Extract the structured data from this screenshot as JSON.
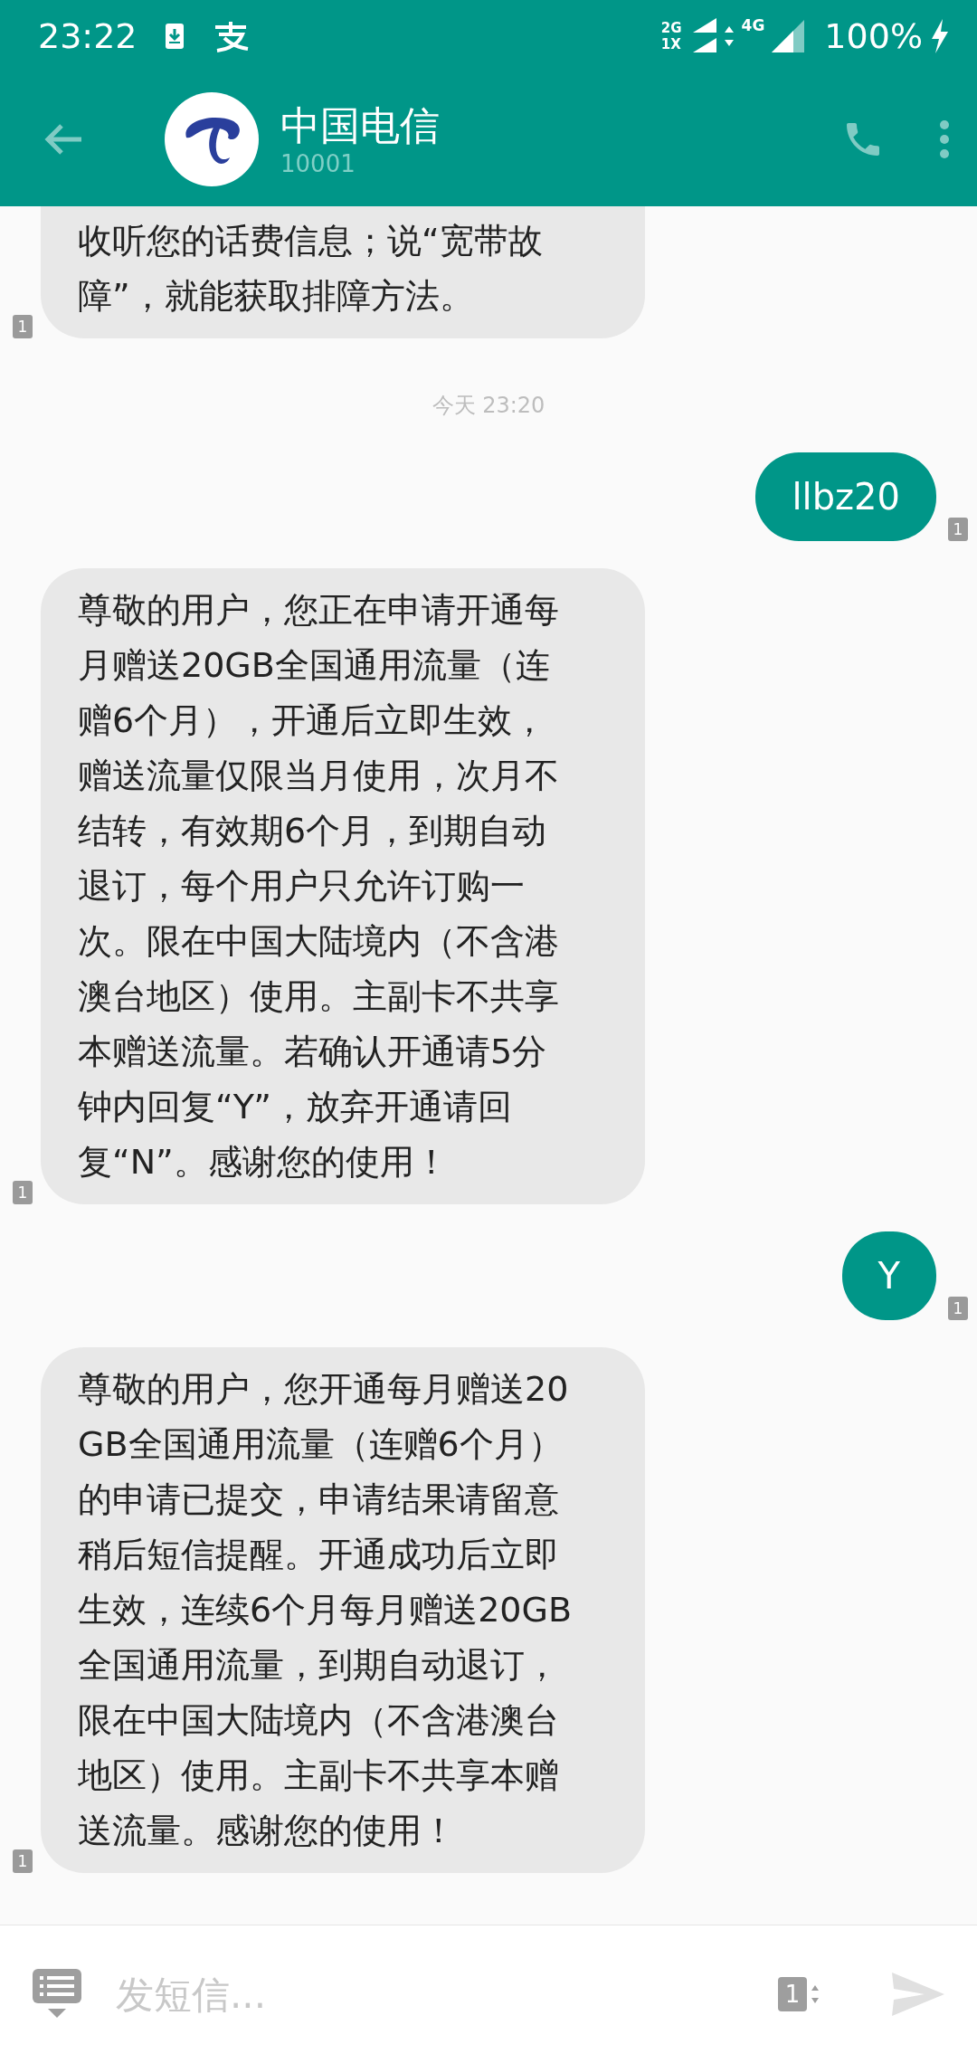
{
  "status_bar": {
    "time": "23:22",
    "network_top": "2G",
    "network_bottom": "1X",
    "network_4g": "4G",
    "battery": "100%"
  },
  "header": {
    "title": "中国电信",
    "subtitle": "10001"
  },
  "messages": [
    {
      "kind": "incoming",
      "text": "收听您的话费信息；说“宽带故障”，就能获取排障方法。",
      "sim": "1",
      "cut_top": true
    },
    {
      "kind": "timestamp",
      "text": "今天 23:20"
    },
    {
      "kind": "outgoing",
      "text": "llbz20",
      "sim": "1"
    },
    {
      "kind": "incoming",
      "text": "尊敬的用户，您正在申请开通每月赠送20GB全国通用流量（连赠6个月），开通后立即生效，赠送流量仅限当月使用，次月不结转，有效期6个月，到期自动退订，每个用户只允许订购一次。限在中国大陆境内（不含港澳台地区）使用。主副卡不共享本赠送流量。若确认开通请5分钟内回复“Y”，放弃开通请回复“N”。感谢您的使用！",
      "sim": "1"
    },
    {
      "kind": "outgoing",
      "text": "Y",
      "sim": "1"
    },
    {
      "kind": "incoming",
      "text": "尊敬的用户，您开通每月赠送20GB全国通用流量（连赠6个月）的申请已提交，申请结果请留意稍后短信提醒。开通成功后立即生效，连续6个月每月赠送20GB全国通用流量，到期自动退订，限在中国大陆境内（不含港澳台地区）使用。主副卡不共享本赠送流量。感谢您的使用！",
      "sim": "1"
    }
  ],
  "composer": {
    "placeholder": "发短信...",
    "sim": "1"
  }
}
